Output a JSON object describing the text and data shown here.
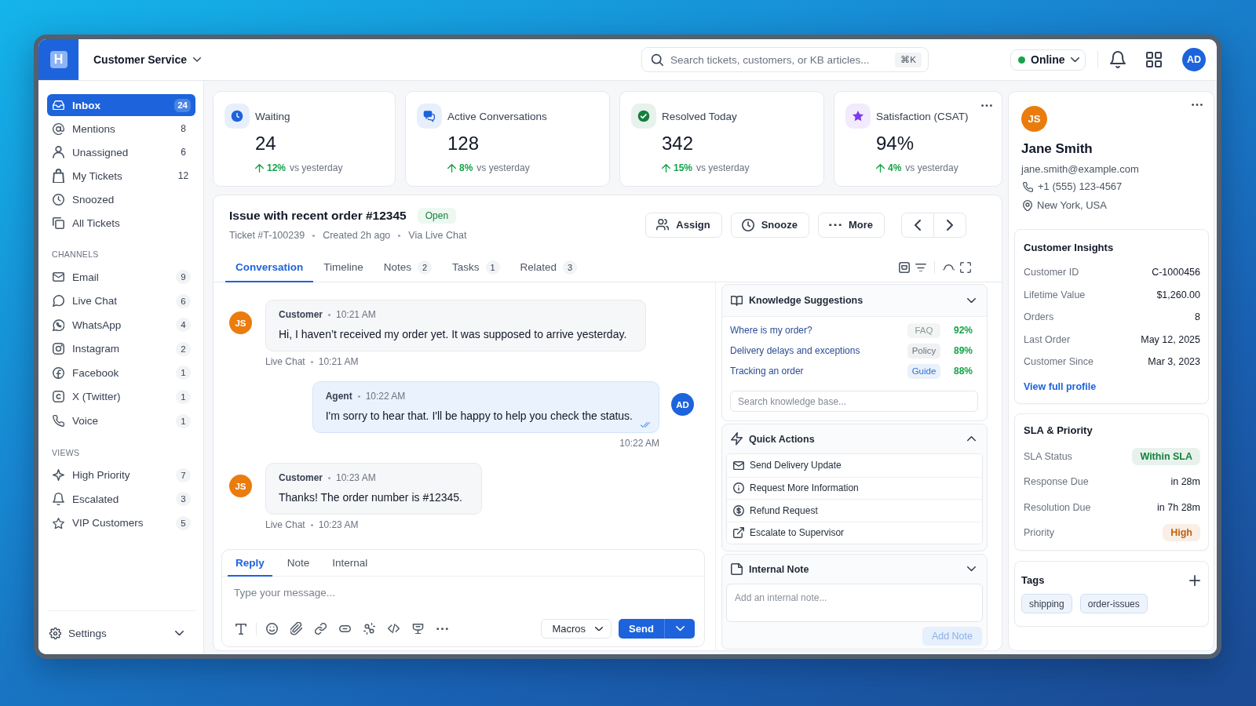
{
  "header": {
    "logo": "H",
    "workspace": "Customer Service",
    "search": {
      "placeholder": "Search tickets, customers, or KB articles...",
      "shortcut": "⌘K"
    },
    "status": {
      "label": "Online",
      "online": true
    },
    "user": {
      "initials": "AD"
    }
  },
  "sidebar": {
    "items": [
      {
        "label": "Inbox",
        "count": "24",
        "selected": true
      },
      {
        "label": "Mentions",
        "count": "8",
        "selected": false
      },
      {
        "label": "Unassigned",
        "count": "6",
        "selected": false
      },
      {
        "label": "My Tickets",
        "count": "12",
        "selected": false
      },
      {
        "label": "Snoozed",
        "selected": false
      },
      {
        "label": "All Tickets",
        "selected": false
      }
    ],
    "sections": [
      {
        "title": "CHANNELS",
        "items": [
          {
            "label": "Email",
            "count": "9",
            "selected": false
          },
          {
            "label": "Live Chat",
            "count": "6",
            "selected": false
          },
          {
            "label": "WhatsApp",
            "count": "4",
            "selected": false
          },
          {
            "label": "Instagram",
            "count": "2",
            "selected": false
          },
          {
            "label": "Facebook",
            "count": "1",
            "selected": false
          },
          {
            "label": "X (Twitter)",
            "count": "1",
            "selected": false
          },
          {
            "label": "Voice",
            "count": "1",
            "selected": false
          }
        ]
      },
      {
        "title": "VIEWS",
        "items": [
          {
            "label": "High Priority",
            "count": "7",
            "selected": false
          },
          {
            "label": "Escalated",
            "count": "3",
            "selected": false
          },
          {
            "label": "VIP Customers",
            "count": "5",
            "selected": false
          }
        ]
      }
    ],
    "settings": {
      "label": "Settings"
    }
  },
  "stats": [
    {
      "title": "Waiting",
      "value": "24",
      "change": "12%",
      "comparison": "vs yesterday",
      "menu": false
    },
    {
      "title": "Active Conversations",
      "value": "128",
      "change": "8%",
      "comparison": "vs yesterday",
      "menu": false
    },
    {
      "title": "Resolved Today",
      "value": "342",
      "change": "15%",
      "comparison": "vs yesterday",
      "menu": false
    },
    {
      "title": "Satisfaction (CSAT)",
      "value": "94%",
      "change": "4%",
      "comparison": "vs yesterday",
      "menu": true
    }
  ],
  "ticket": {
    "title": "Issue with recent order #12345",
    "status": "Open",
    "meta": [
      "Ticket #T-100239",
      "Created 2h ago",
      "Via Live Chat"
    ],
    "actions": [
      "Assign",
      "Snooze",
      "More"
    ],
    "tabs": [
      {
        "label": "Conversation",
        "selected": true
      },
      {
        "label": "Timeline",
        "selected": false
      },
      {
        "label": "Notes",
        "count": "2",
        "selected": false
      },
      {
        "label": "Tasks",
        "count": "1",
        "selected": false
      },
      {
        "label": "Related",
        "count": "3",
        "selected": false
      }
    ]
  },
  "messages": [
    {
      "kind": "customer",
      "initials": "JS",
      "author": "Customer",
      "time": "10:21 AM",
      "text": "Hi, I haven’t received my order yet. It was supposed to arrive yesterday.",
      "read": false,
      "footer": {
        "channel": "Live Chat",
        "time": "10:21 AM"
      }
    },
    {
      "kind": "agent",
      "initials": "AD",
      "author": "Agent",
      "time": "10:22 AM",
      "text": "I'm sorry to hear that. I'll be happy to help you check the status.",
      "read": true,
      "footer": {
        "time": "10:22 AM"
      }
    },
    {
      "kind": "customer",
      "initials": "JS",
      "author": "Customer",
      "time": "10:23 AM",
      "text": "Thanks! The order number is #12345.",
      "read": false,
      "footer": {
        "channel": "Live Chat",
        "time": "10:23 AM"
      }
    }
  ],
  "composer": {
    "tabs": [
      {
        "label": "Reply",
        "selected": true
      },
      {
        "label": "Note",
        "selected": false
      },
      {
        "label": "Internal",
        "selected": false
      }
    ],
    "placeholder": "Type your message...",
    "macros": "Macros",
    "send": "Send"
  },
  "knowledge": {
    "title": "Knowledge Suggestions",
    "items": [
      {
        "title": "Where is my order?",
        "tag": "FAQ",
        "color": "#8a9b91",
        "score": "92%"
      },
      {
        "title": "Delivery delays and exceptions",
        "tag": "Policy",
        "color": "#6b7280",
        "score": "89%"
      },
      {
        "title": "Tracking an order",
        "tag": "Guide",
        "color": "#2f6fd6",
        "score": "88%"
      }
    ],
    "search": {
      "placeholder": "Search knowledge base..."
    }
  },
  "quick_actions": {
    "title": "Quick Actions",
    "items": [
      "Send Delivery Update",
      "Request More Information",
      "Refund Request",
      "Escalate to Supervisor"
    ]
  },
  "internal_note": {
    "title": "Internal Note",
    "placeholder": "Add an internal note...",
    "button": {
      "label": "Add Note",
      "disabled": true
    }
  },
  "customer": {
    "initials": "JS",
    "name": "Jane Smith",
    "email": "jane.smith@example.com",
    "phone": "+1 (555) 123-4567",
    "location": "New York, USA"
  },
  "insights": {
    "title": "Customer Insights",
    "rows": [
      {
        "label": "Customer ID",
        "value": "C-1000456"
      },
      {
        "label": "Lifetime Value",
        "value": "$1,260.00"
      },
      {
        "label": "Orders",
        "value": "8"
      },
      {
        "label": "Last Order",
        "value": "May 12, 2025"
      },
      {
        "label": "Customer Since",
        "value": "Mar 3, 2023"
      }
    ],
    "link": "View full profile"
  },
  "sla": {
    "title": "SLA & Priority",
    "rows": [
      {
        "label": "SLA Status",
        "value": "Within SLA",
        "kind": "badge",
        "color": "#15803d"
      },
      {
        "label": "Response Due",
        "value": "in 28m",
        "kind": "text"
      },
      {
        "label": "Resolution Due",
        "value": "in 7h 28m",
        "kind": "text"
      },
      {
        "label": "Priority",
        "value": "High",
        "kind": "badge",
        "color": "#c2620b"
      }
    ]
  },
  "tags": {
    "title": "Tags",
    "items": [
      "shipping",
      "order-issues"
    ]
  }
}
